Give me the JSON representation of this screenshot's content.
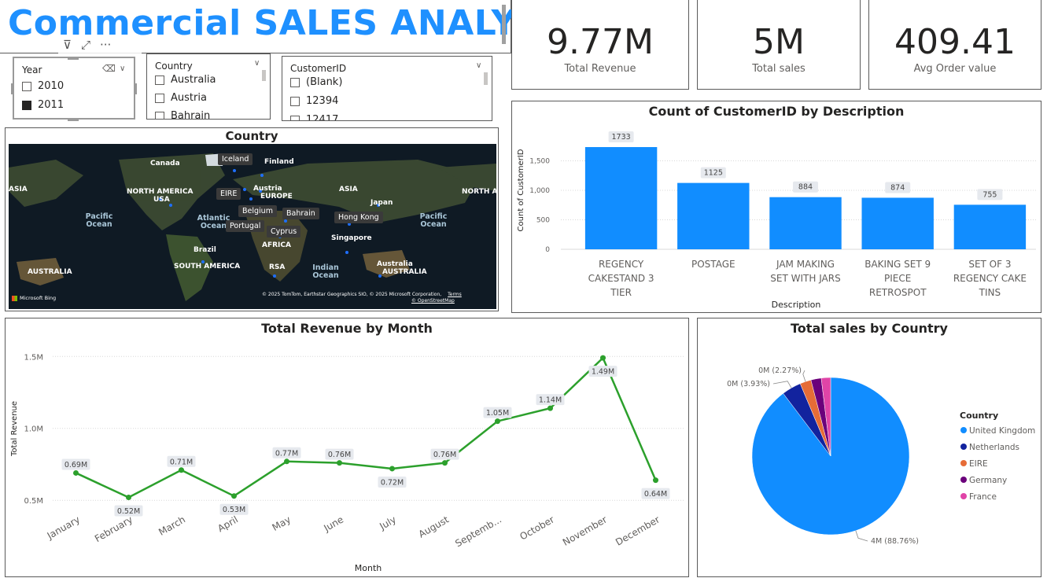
{
  "header": {
    "title": "Commercial SALES ANALYSIS"
  },
  "kpis": [
    {
      "value": "9.77M",
      "label": "Total Revenue"
    },
    {
      "value": "5M",
      "label": "Total sales"
    },
    {
      "value": "409.41",
      "label": "Avg Order value"
    }
  ],
  "slicers": {
    "year": {
      "title": "Year",
      "options": [
        {
          "label": "2010",
          "checked": false
        },
        {
          "label": "2011",
          "checked": true
        }
      ]
    },
    "country": {
      "title": "Country",
      "options": [
        "Australia",
        "Austria",
        "Bahrain"
      ]
    },
    "customer": {
      "title": "CustomerID",
      "options": [
        "(Blank)",
        "12394",
        "12417"
      ]
    }
  },
  "map": {
    "title": "Country",
    "regions": [
      "NORTH AMERICA",
      "EUROPE",
      "ASIA",
      "AFRICA",
      "SOUTH AMERICA",
      "AUSTRALIA",
      "AUSTRALIA",
      "ASIA",
      "NORTH A"
    ],
    "oceans": [
      "Pacific Ocean",
      "Atlantic Ocean",
      "Indian Ocean",
      "Pacific Ocean"
    ],
    "countries": [
      "Canada",
      "Iceland",
      "Finland",
      "USA",
      "EIRE",
      "Austria",
      "Belgium",
      "Bahrain",
      "Japan",
      "Hong Kong",
      "Portugal",
      "Cyprus",
      "Singapore",
      "Brazil",
      "RSA",
      "Australia"
    ],
    "attribution": "© 2025 TomTom, Earthstar Geographics SIO, © 2025 Microsoft Corporation,",
    "terms": "Terms",
    "osm": "© OpenStreetMap",
    "bing": "Microsoft Bing"
  },
  "colors": {
    "accent": "#1e90ff",
    "bar": "#118dff",
    "line": "#2ca02c"
  },
  "bar_chart": {
    "title": "Count of CustomerID by Description",
    "chart_data": {
      "type": "bar",
      "title": "Count of CustomerID by Description",
      "xlabel": "Description",
      "ylabel": "Count of CustomerID",
      "categories": [
        "REGENCY CAKESTAND 3 TIER",
        "POSTAGE",
        "JAM MAKING SET WITH JARS",
        "BAKING SET 9 PIECE RETROSPOT",
        "SET OF 3 REGENCY CAKE TINS"
      ],
      "category_lines": [
        [
          "REGENCY",
          "CAKESTAND 3",
          "TIER"
        ],
        [
          "POSTAGE"
        ],
        [
          "JAM MAKING",
          "SET WITH JARS"
        ],
        [
          "BAKING SET 9",
          "PIECE",
          "RETROSPOT"
        ],
        [
          "SET OF 3",
          "REGENCY CAKE",
          "TINS"
        ]
      ],
      "values": [
        1733,
        1125,
        884,
        874,
        755
      ],
      "ylim": [
        0,
        2000
      ],
      "yticks": [
        0,
        500,
        1000,
        1500
      ],
      "ytick_labels": [
        "0",
        "500",
        "1,000",
        "1,500"
      ]
    }
  },
  "line_chart": {
    "title": "Total Revenue by Month",
    "chart_data": {
      "type": "line",
      "title": "Total Revenue by Month",
      "xlabel": "Month",
      "ylabel": "Total Revenue",
      "categories": [
        "January",
        "February",
        "March",
        "April",
        "May",
        "June",
        "July",
        "August",
        "Septemb...",
        "October",
        "November",
        "December"
      ],
      "values": [
        0.69,
        0.52,
        0.71,
        0.53,
        0.77,
        0.76,
        0.72,
        0.76,
        1.05,
        1.14,
        1.49,
        0.64
      ],
      "value_labels": [
        "0.69M",
        "0.52M",
        "0.71M",
        "0.53M",
        "0.77M",
        "0.76M",
        "0.72M",
        "0.76M",
        "1.05M",
        "1.14M",
        "1.49M",
        "0.64M"
      ],
      "label_above": [
        true,
        false,
        true,
        false,
        true,
        true,
        false,
        true,
        true,
        true,
        false,
        false
      ],
      "yticks": [
        0.5,
        1.0,
        1.5
      ],
      "ytick_labels": [
        "0.5M",
        "1.0M",
        "1.5M"
      ],
      "ylim": [
        0.43,
        1.6
      ]
    }
  },
  "pie_chart": {
    "title": "Total sales by Country",
    "legend_title": "Country",
    "chart_data": {
      "type": "pie",
      "title": "Total sales by Country",
      "labels": [
        "United Kingdom",
        "Netherlands",
        "EIRE",
        "Germany",
        "France"
      ],
      "values": [
        88.76,
        3.93,
        2.27,
        2.1,
        1.9
      ],
      "colors": [
        "#118dff",
        "#12239e",
        "#e66c37",
        "#6b007b",
        "#e044a7"
      ],
      "data_labels": [
        "4M (88.76%)",
        "0M (3.93%)",
        "0M (2.27%)"
      ],
      "legend": "right"
    }
  }
}
